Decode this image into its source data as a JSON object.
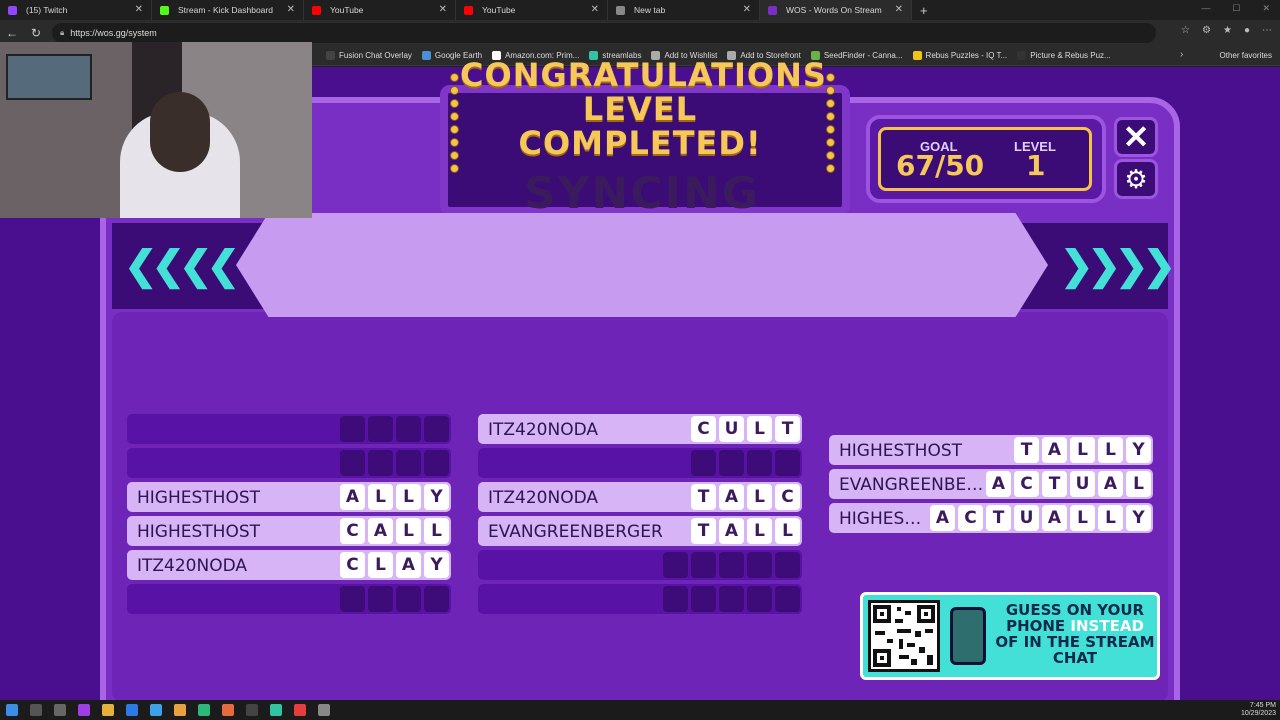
{
  "browser": {
    "tabs": [
      {
        "label": "(15) Twitch",
        "color": "#9146ff",
        "active": false
      },
      {
        "label": "Stream - Kick Dashboard",
        "color": "#53fc18",
        "active": false
      },
      {
        "label": "YouTube",
        "color": "#ff0000",
        "active": false
      },
      {
        "label": "YouTube",
        "color": "#ff0000",
        "active": false
      },
      {
        "label": "New tab",
        "color": "#888888",
        "active": false
      },
      {
        "label": "WOS - Words On Stream",
        "color": "#7a2fc4",
        "active": true
      }
    ],
    "new_tab_symbol": "+",
    "url": "https://wos.gg/system",
    "bookmarks": [
      {
        "label": "Fusion Chat Overlay",
        "color": "#444444"
      },
      {
        "label": "Google Earth",
        "color": "#4a90d9"
      },
      {
        "label": "Amazon.com: Prim...",
        "color": "#ffffff"
      },
      {
        "label": "streamlabs",
        "color": "#31c3a2"
      },
      {
        "label": "Add to Wishlist",
        "color": "#aaaaaa"
      },
      {
        "label": "Add to Storefront",
        "color": "#aaaaaa"
      },
      {
        "label": "SeedFinder - Canna...",
        "color": "#6ab04c"
      },
      {
        "label": "Rebus Puzzles - IQ T...",
        "color": "#f0c419"
      },
      {
        "label": "Picture & Rebus Puz...",
        "color": "#333333"
      }
    ],
    "other_favorites": "Other favorites"
  },
  "game": {
    "title_line1": "CONGRATULATIONS",
    "title_line2": "LEVEL COMPLETED!",
    "goal_label": "GOAL",
    "goal_value": "67/50",
    "level_label": "LEVEL",
    "level_value": "1",
    "close_symbol": "✕",
    "gear_symbol": "⚙",
    "status_banner": "SYNCING",
    "chevrons_left": "❮❮❮❮",
    "chevrons_right": "❯❯❯❯",
    "columns": [
      {
        "rows": [
          {
            "player": "",
            "letters": [
              "",
              "",
              "",
              ""
            ]
          },
          {
            "player": "",
            "letters": [
              "",
              "",
              "",
              ""
            ]
          },
          {
            "player": "HIGHESTHOST",
            "letters": [
              "A",
              "L",
              "L",
              "Y"
            ]
          },
          {
            "player": "HIGHESTHOST",
            "letters": [
              "C",
              "A",
              "L",
              "L"
            ]
          },
          {
            "player": "ITZ420NODA",
            "letters": [
              "C",
              "L",
              "A",
              "Y"
            ]
          },
          {
            "player": "",
            "letters": [
              "",
              "",
              "",
              ""
            ]
          }
        ]
      },
      {
        "rows": [
          {
            "player": "ITZ420NODA",
            "letters": [
              "C",
              "U",
              "L",
              "T"
            ]
          },
          {
            "player": "",
            "letters": [
              "",
              "",
              "",
              ""
            ]
          },
          {
            "player": "ITZ420NODA",
            "letters": [
              "T",
              "A",
              "L",
              "C"
            ]
          },
          {
            "player": "EVANGREENBERGER",
            "letters": [
              "T",
              "A",
              "L",
              "L"
            ]
          },
          {
            "player": "",
            "letters": [
              "",
              "",
              "",
              "",
              ""
            ]
          },
          {
            "player": "",
            "letters": [
              "",
              "",
              "",
              "",
              ""
            ]
          }
        ]
      },
      {
        "rows": [
          {
            "player": "HIGHESTHOST",
            "letters": [
              "T",
              "A",
              "L",
              "L",
              "Y"
            ]
          },
          {
            "player": "EVANGREENBE…",
            "letters": [
              "A",
              "C",
              "T",
              "U",
              "A",
              "L"
            ]
          },
          {
            "player": "HIGHES…",
            "letters": [
              "A",
              "C",
              "T",
              "U",
              "A",
              "L",
              "L",
              "Y"
            ]
          }
        ]
      }
    ],
    "promo": {
      "line_a": "GUESS ON YOUR",
      "line_b1": "PHONE",
      "line_b2": "INSTEAD",
      "line_c": "OF IN THE STREAM",
      "line_d": "CHAT"
    }
  },
  "taskbar": {
    "time": "7:45 PM",
    "date": "10/29/2023"
  }
}
